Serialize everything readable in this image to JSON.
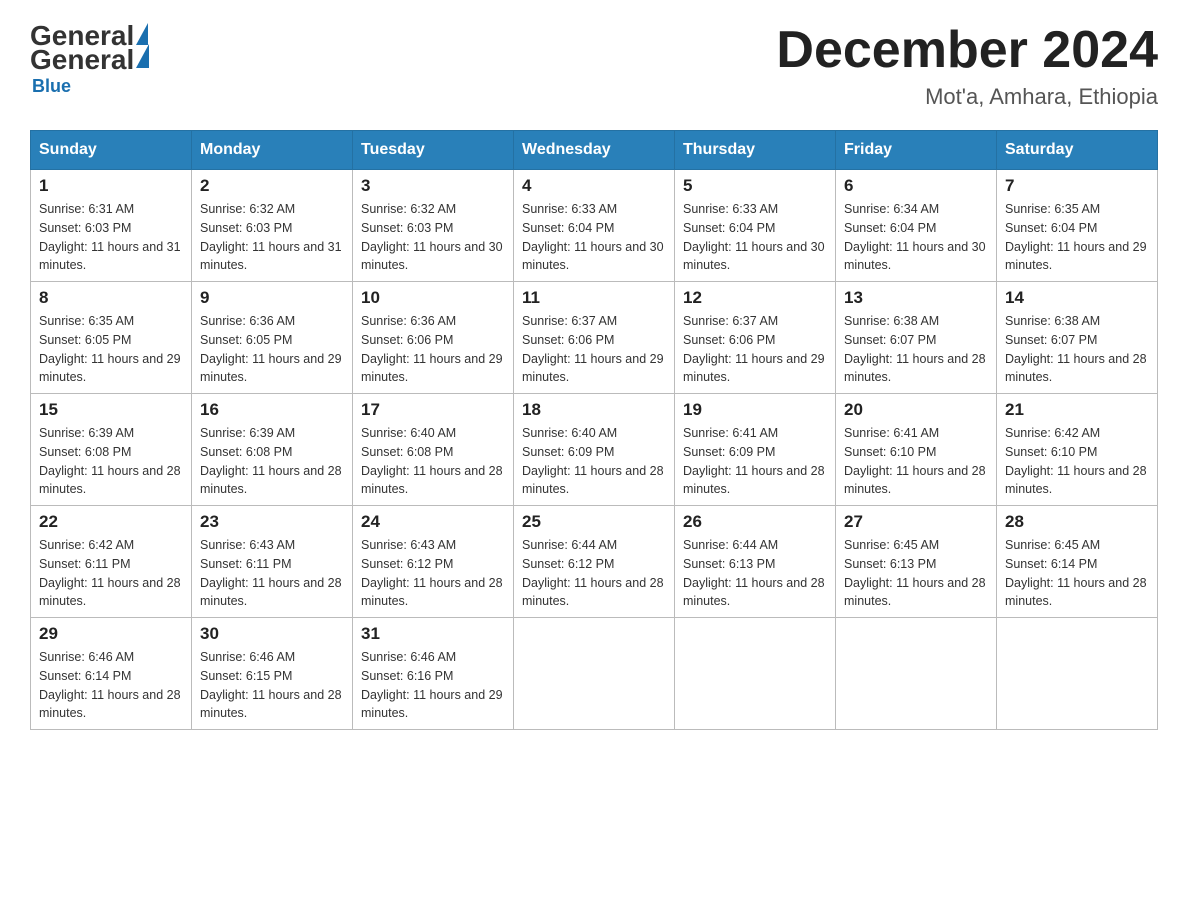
{
  "header": {
    "logo_general": "General",
    "logo_blue": "Blue",
    "month_title": "December 2024",
    "location": "Mot'a, Amhara, Ethiopia"
  },
  "days_of_week": [
    "Sunday",
    "Monday",
    "Tuesday",
    "Wednesday",
    "Thursday",
    "Friday",
    "Saturday"
  ],
  "weeks": [
    [
      {
        "day": "1",
        "sunrise": "6:31 AM",
        "sunset": "6:03 PM",
        "daylight": "11 hours and 31 minutes."
      },
      {
        "day": "2",
        "sunrise": "6:32 AM",
        "sunset": "6:03 PM",
        "daylight": "11 hours and 31 minutes."
      },
      {
        "day": "3",
        "sunrise": "6:32 AM",
        "sunset": "6:03 PM",
        "daylight": "11 hours and 30 minutes."
      },
      {
        "day": "4",
        "sunrise": "6:33 AM",
        "sunset": "6:04 PM",
        "daylight": "11 hours and 30 minutes."
      },
      {
        "day": "5",
        "sunrise": "6:33 AM",
        "sunset": "6:04 PM",
        "daylight": "11 hours and 30 minutes."
      },
      {
        "day": "6",
        "sunrise": "6:34 AM",
        "sunset": "6:04 PM",
        "daylight": "11 hours and 30 minutes."
      },
      {
        "day": "7",
        "sunrise": "6:35 AM",
        "sunset": "6:04 PM",
        "daylight": "11 hours and 29 minutes."
      }
    ],
    [
      {
        "day": "8",
        "sunrise": "6:35 AM",
        "sunset": "6:05 PM",
        "daylight": "11 hours and 29 minutes."
      },
      {
        "day": "9",
        "sunrise": "6:36 AM",
        "sunset": "6:05 PM",
        "daylight": "11 hours and 29 minutes."
      },
      {
        "day": "10",
        "sunrise": "6:36 AM",
        "sunset": "6:06 PM",
        "daylight": "11 hours and 29 minutes."
      },
      {
        "day": "11",
        "sunrise": "6:37 AM",
        "sunset": "6:06 PM",
        "daylight": "11 hours and 29 minutes."
      },
      {
        "day": "12",
        "sunrise": "6:37 AM",
        "sunset": "6:06 PM",
        "daylight": "11 hours and 29 minutes."
      },
      {
        "day": "13",
        "sunrise": "6:38 AM",
        "sunset": "6:07 PM",
        "daylight": "11 hours and 28 minutes."
      },
      {
        "day": "14",
        "sunrise": "6:38 AM",
        "sunset": "6:07 PM",
        "daylight": "11 hours and 28 minutes."
      }
    ],
    [
      {
        "day": "15",
        "sunrise": "6:39 AM",
        "sunset": "6:08 PM",
        "daylight": "11 hours and 28 minutes."
      },
      {
        "day": "16",
        "sunrise": "6:39 AM",
        "sunset": "6:08 PM",
        "daylight": "11 hours and 28 minutes."
      },
      {
        "day": "17",
        "sunrise": "6:40 AM",
        "sunset": "6:08 PM",
        "daylight": "11 hours and 28 minutes."
      },
      {
        "day": "18",
        "sunrise": "6:40 AM",
        "sunset": "6:09 PM",
        "daylight": "11 hours and 28 minutes."
      },
      {
        "day": "19",
        "sunrise": "6:41 AM",
        "sunset": "6:09 PM",
        "daylight": "11 hours and 28 minutes."
      },
      {
        "day": "20",
        "sunrise": "6:41 AM",
        "sunset": "6:10 PM",
        "daylight": "11 hours and 28 minutes."
      },
      {
        "day": "21",
        "sunrise": "6:42 AM",
        "sunset": "6:10 PM",
        "daylight": "11 hours and 28 minutes."
      }
    ],
    [
      {
        "day": "22",
        "sunrise": "6:42 AM",
        "sunset": "6:11 PM",
        "daylight": "11 hours and 28 minutes."
      },
      {
        "day": "23",
        "sunrise": "6:43 AM",
        "sunset": "6:11 PM",
        "daylight": "11 hours and 28 minutes."
      },
      {
        "day": "24",
        "sunrise": "6:43 AM",
        "sunset": "6:12 PM",
        "daylight": "11 hours and 28 minutes."
      },
      {
        "day": "25",
        "sunrise": "6:44 AM",
        "sunset": "6:12 PM",
        "daylight": "11 hours and 28 minutes."
      },
      {
        "day": "26",
        "sunrise": "6:44 AM",
        "sunset": "6:13 PM",
        "daylight": "11 hours and 28 minutes."
      },
      {
        "day": "27",
        "sunrise": "6:45 AM",
        "sunset": "6:13 PM",
        "daylight": "11 hours and 28 minutes."
      },
      {
        "day": "28",
        "sunrise": "6:45 AM",
        "sunset": "6:14 PM",
        "daylight": "11 hours and 28 minutes."
      }
    ],
    [
      {
        "day": "29",
        "sunrise": "6:46 AM",
        "sunset": "6:14 PM",
        "daylight": "11 hours and 28 minutes."
      },
      {
        "day": "30",
        "sunrise": "6:46 AM",
        "sunset": "6:15 PM",
        "daylight": "11 hours and 28 minutes."
      },
      {
        "day": "31",
        "sunrise": "6:46 AM",
        "sunset": "6:16 PM",
        "daylight": "11 hours and 29 minutes."
      },
      null,
      null,
      null,
      null
    ]
  ],
  "labels": {
    "sunrise": "Sunrise:",
    "sunset": "Sunset:",
    "daylight": "Daylight:"
  }
}
